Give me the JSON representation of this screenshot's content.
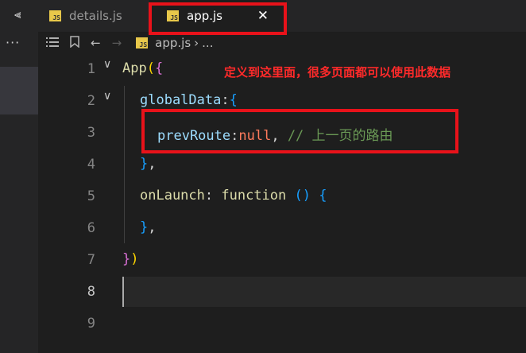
{
  "sidebar": {
    "collapse_glyph": "⫷",
    "more_glyph": "···"
  },
  "tabs": [
    {
      "label": "details.js",
      "icon": "js-file-icon",
      "active": false
    },
    {
      "label": "app.js",
      "icon": "js-file-icon",
      "active": true,
      "close_glyph": "✕"
    }
  ],
  "breadcrumb": {
    "file": "app.js",
    "separator": "›",
    "ellipsis": "..."
  },
  "editor": {
    "lines": [
      {
        "num": "1",
        "tokens": [
          [
            "k-yellow",
            "App"
          ],
          [
            "k-gold",
            "("
          ],
          [
            "k-pink",
            "{"
          ]
        ]
      },
      {
        "num": "2",
        "tokens": [
          [
            "k-prop",
            "globalData"
          ],
          [
            "k-plain",
            ":"
          ],
          [
            "k-blue",
            "{"
          ]
        ]
      },
      {
        "num": "3",
        "tokens": [
          [
            "k-prop",
            "prevRoute"
          ],
          [
            "k-plain",
            ":"
          ],
          [
            "k-null",
            "null"
          ],
          [
            "k-plain",
            ", "
          ],
          [
            "k-comment",
            "// 上一页的路由"
          ]
        ]
      },
      {
        "num": "4",
        "tokens": [
          [
            "k-blue",
            "}"
          ],
          [
            "k-plain",
            ","
          ]
        ]
      },
      {
        "num": "5",
        "tokens": [
          [
            "k-yellow",
            "onLaunch"
          ],
          [
            "k-plain",
            ": "
          ],
          [
            "k-yellow",
            "function"
          ],
          [
            "k-plain",
            " "
          ],
          [
            "k-blue",
            "("
          ],
          [
            "k-blue",
            ")"
          ],
          [
            "k-plain",
            " "
          ],
          [
            "k-blue",
            "{"
          ]
        ]
      },
      {
        "num": "6",
        "tokens": [
          [
            "k-blue",
            "}"
          ],
          [
            "k-plain",
            ","
          ]
        ]
      },
      {
        "num": "7",
        "tokens": [
          [
            "k-pink",
            "}"
          ],
          [
            "k-gold",
            ")"
          ]
        ]
      },
      {
        "num": "8",
        "tokens": []
      },
      {
        "num": "9",
        "tokens": []
      }
    ],
    "current_line": "8"
  },
  "annotation": {
    "text": "定义到这里面，很多页面都可以使用此数据",
    "color": "#ff2a2a"
  },
  "colors": {
    "highlight_box": "#e8121a",
    "js_badge": "#e8c84a"
  }
}
